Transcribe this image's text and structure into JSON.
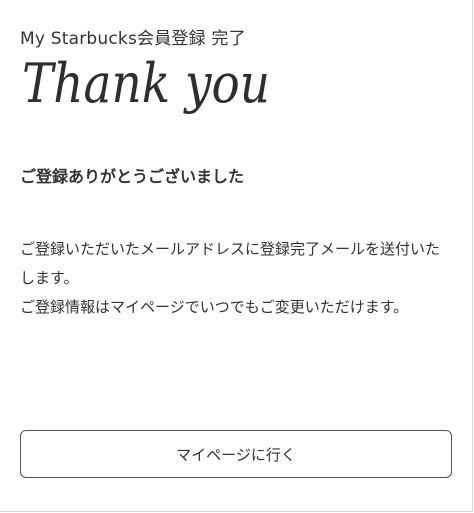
{
  "page_title": "My Starbucks会員登録 完了",
  "hero_text": "Thank you",
  "heading": "ご登録ありがとうございました",
  "message": {
    "line1": "ご登録いただいたメールアドレスに登録完了メールを送付いたします。",
    "line2": "ご登録情報はマイページでいつでもご変更いただけます。"
  },
  "buttons": {
    "mypage_label": "マイページに行く"
  },
  "colors": {
    "text": "#333333",
    "button_border": "#555555",
    "background": "#ffffff"
  }
}
